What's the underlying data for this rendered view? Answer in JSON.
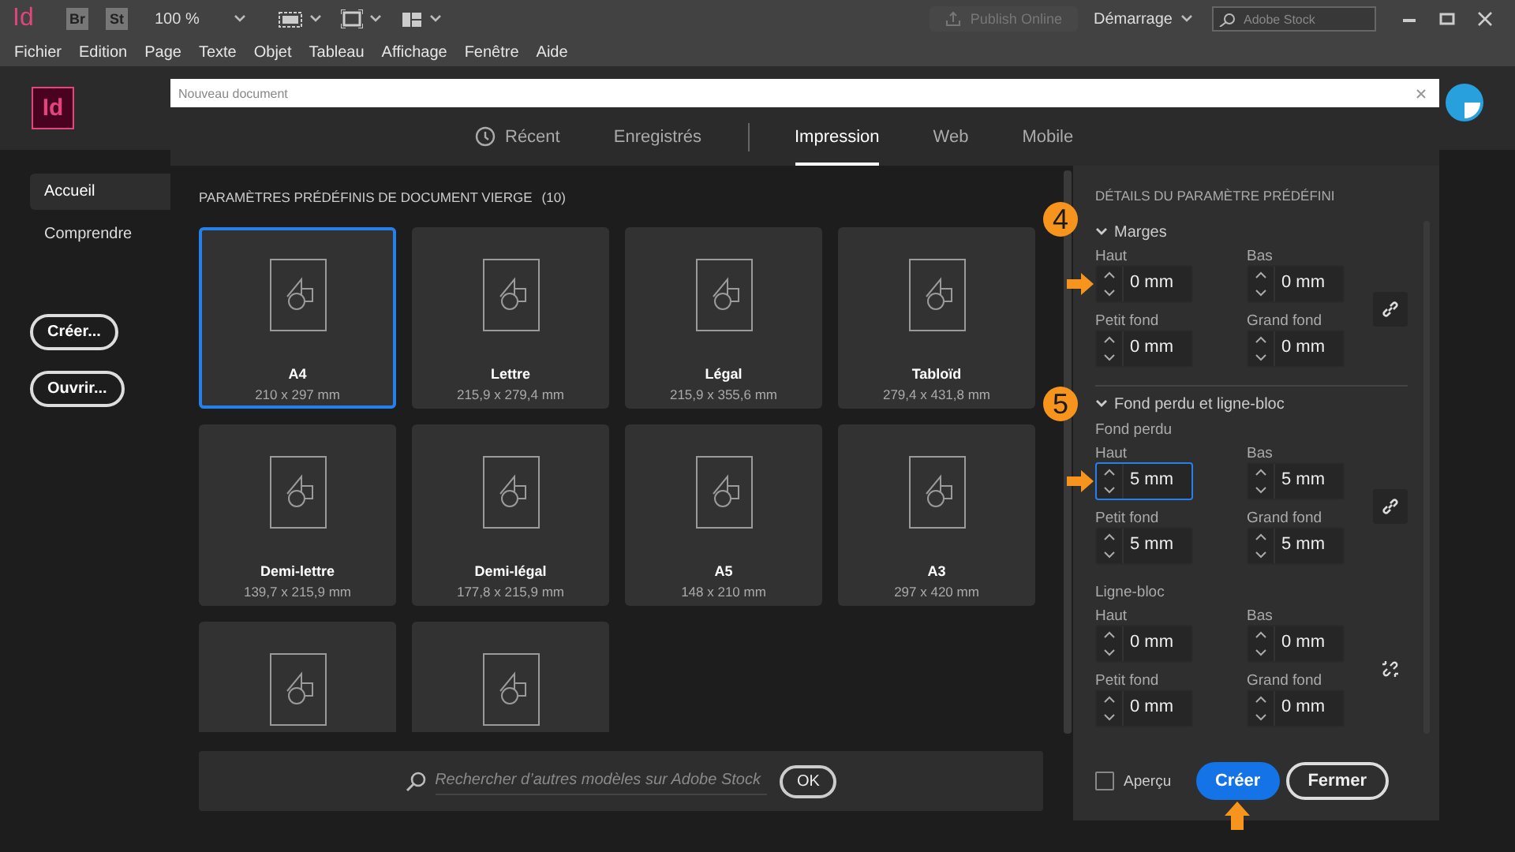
{
  "app_bar": {
    "logo": "Id",
    "bridge": "Br",
    "stock": "St",
    "zoom": "100 %",
    "publish": {
      "label": "Publish Online",
      "disabled": true
    },
    "workspace": "Démarrage",
    "search": {
      "placeholder": "Adobe Stock"
    }
  },
  "menu": [
    "Fichier",
    "Edition",
    "Page",
    "Texte",
    "Objet",
    "Tableau",
    "Affichage",
    "Fenêtre",
    "Aide"
  ],
  "home": {
    "logo": "Id",
    "nav": [
      {
        "label": "Accueil",
        "selected": true
      },
      {
        "label": "Comprendre",
        "selected": false
      }
    ],
    "buttons": [
      "Créer...",
      "Ouvrir..."
    ]
  },
  "dialog": {
    "title": "Nouveau document",
    "tabs": [
      {
        "label": "Récent",
        "selected": false,
        "kind": "history"
      },
      {
        "label": "Enregistrés",
        "selected": false,
        "kind": "plain"
      },
      {
        "label": "Impression",
        "selected": true,
        "kind": "plain"
      },
      {
        "label": "Web",
        "selected": false,
        "kind": "plain"
      },
      {
        "label": "Mobile",
        "selected": false,
        "kind": "plain"
      }
    ],
    "presets_heading": "PARAMÈTRES PRÉDÉFINIS DE DOCUMENT VIERGE",
    "presets_count": "(10)",
    "presets": [
      {
        "name": "A4",
        "size": "210 x 297 mm",
        "selected": true
      },
      {
        "name": "Lettre",
        "size": "215,9 x 279,4 mm",
        "selected": false
      },
      {
        "name": "Légal",
        "size": "215,9 x 355,6 mm",
        "selected": false
      },
      {
        "name": "Tabloïd",
        "size": "279,4 x 431,8 mm",
        "selected": false
      },
      {
        "name": "Demi-lettre",
        "size": "139,7 x 215,9 mm",
        "selected": false
      },
      {
        "name": "Demi-légal",
        "size": "177,8 x 215,9 mm",
        "selected": false
      },
      {
        "name": "A5",
        "size": "148 x 210 mm",
        "selected": false
      },
      {
        "name": "A3",
        "size": "297 x 420 mm",
        "selected": false
      },
      {
        "selected": false
      },
      {
        "selected": false
      }
    ],
    "stock_search": {
      "placeholder": "Rechercher d’autres modèles sur Adobe Stock",
      "button": "OK"
    },
    "details": {
      "heading": "DÉTAILS DU PARAMÈTRE PRÉDÉFINI",
      "sections": [
        {
          "title": "Marges",
          "expanded": true,
          "badge": "4",
          "groups": [
            {
              "linked": true,
              "fields": [
                {
                  "label": "Haut",
                  "value": "0 mm",
                  "focused": false,
                  "pointer": true
                },
                {
                  "label": "Bas",
                  "value": "0 mm",
                  "focused": false,
                  "pointer": false
                },
                {
                  "label": "Petit fond",
                  "value": "0 mm",
                  "focused": false,
                  "pointer": false
                },
                {
                  "label": "Grand fond",
                  "value": "0 mm",
                  "focused": false,
                  "pointer": false
                }
              ]
            }
          ]
        },
        {
          "title": "Fond perdu et ligne-bloc",
          "expanded": true,
          "badge": "5",
          "groups": [
            {
              "label": "Fond perdu",
              "linked": true,
              "fields": [
                {
                  "label": "Haut",
                  "value": "5 mm",
                  "focused": true,
                  "pointer": true
                },
                {
                  "label": "Bas",
                  "value": "5 mm",
                  "focused": false,
                  "pointer": false
                },
                {
                  "label": "Petit fond",
                  "value": "5 mm",
                  "focused": false,
                  "pointer": false
                },
                {
                  "label": "Grand fond",
                  "value": "5 mm",
                  "focused": false,
                  "pointer": false
                }
              ]
            },
            {
              "label": "Ligne-bloc",
              "linked": false,
              "fields": [
                {
                  "label": "Haut",
                  "value": "0 mm",
                  "focused": false,
                  "pointer": false
                },
                {
                  "label": "Bas",
                  "value": "0 mm",
                  "focused": false,
                  "pointer": false
                },
                {
                  "label": "Petit fond",
                  "value": "0 mm",
                  "focused": false,
                  "pointer": false
                },
                {
                  "label": "Grand fond",
                  "value": "0 mm",
                  "focused": false,
                  "pointer": false
                }
              ]
            }
          ]
        }
      ]
    },
    "preview": {
      "label": "Aperçu",
      "checked": false
    },
    "buttons": [
      {
        "label": "Créer",
        "kind": "primary",
        "pointer": true
      },
      {
        "label": "Fermer",
        "kind": "secondary",
        "pointer": false
      }
    ]
  }
}
